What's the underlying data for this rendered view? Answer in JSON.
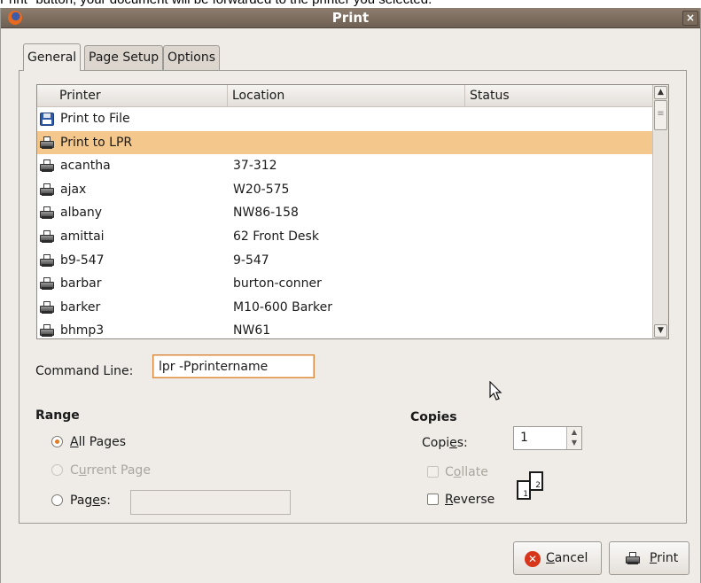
{
  "background": {
    "text": "Print\" button, your document will be forwarded to the printer you selected."
  },
  "window": {
    "title": "Print",
    "close_glyph": "×",
    "app_icon": "firefox-icon"
  },
  "tabs": [
    {
      "label": "General",
      "active": true
    },
    {
      "label": "Page Setup",
      "active": false
    },
    {
      "label": "Options",
      "active": false
    }
  ],
  "printer_list": {
    "columns": [
      "Printer",
      "Location",
      "Status"
    ],
    "rows": [
      {
        "name": "Print to File",
        "location": "",
        "status": "",
        "icon": "save-file-icon",
        "selected": false
      },
      {
        "name": "Print to LPR",
        "location": "",
        "status": "",
        "icon": "printer-icon",
        "selected": true
      },
      {
        "name": "acantha",
        "location": "37-312",
        "status": "",
        "icon": "printer-icon",
        "selected": false
      },
      {
        "name": "ajax",
        "location": "W20-575",
        "status": "",
        "icon": "printer-icon",
        "selected": false
      },
      {
        "name": "albany",
        "location": "NW86-158",
        "status": "",
        "icon": "printer-icon",
        "selected": false
      },
      {
        "name": "amittai",
        "location": "62 Front Desk",
        "status": "",
        "icon": "printer-icon",
        "selected": false
      },
      {
        "name": "b9-547",
        "location": "9-547",
        "status": "",
        "icon": "printer-icon",
        "selected": false
      },
      {
        "name": "barbar",
        "location": "burton-conner",
        "status": "",
        "icon": "printer-icon",
        "selected": false
      },
      {
        "name": "barker",
        "location": "M10-600 Barker",
        "status": "",
        "icon": "printer-icon",
        "selected": false
      },
      {
        "name": "bhmp3",
        "location": "NW61",
        "status": "",
        "icon": "printer-icon",
        "selected": false
      }
    ]
  },
  "command_line": {
    "label": "Command Line:",
    "value": "lpr -Pprintername"
  },
  "range": {
    "title": "Range",
    "options": [
      {
        "label": "All Pages",
        "mnemonic_index": 0,
        "selected": true,
        "enabled": true
      },
      {
        "label": "Current Page",
        "mnemonic_index": 1,
        "selected": false,
        "enabled": false
      },
      {
        "label": "Pages:",
        "mnemonic_index": 3,
        "selected": false,
        "enabled": true
      }
    ],
    "pages_value": ""
  },
  "copies": {
    "title": "Copies",
    "label": "Copies:",
    "value": "1",
    "collate_label": "Collate",
    "reverse_label": "Reverse",
    "collate_checked": false,
    "reverse_checked": false,
    "collate_enabled": false,
    "preview_pages": [
      "1",
      "2"
    ]
  },
  "buttons": {
    "cancel": "Cancel",
    "print": "Print"
  },
  "colors": {
    "selection": "#f4c88d",
    "titlebar": "#7b6c5f",
    "focus": "#d5883d"
  }
}
